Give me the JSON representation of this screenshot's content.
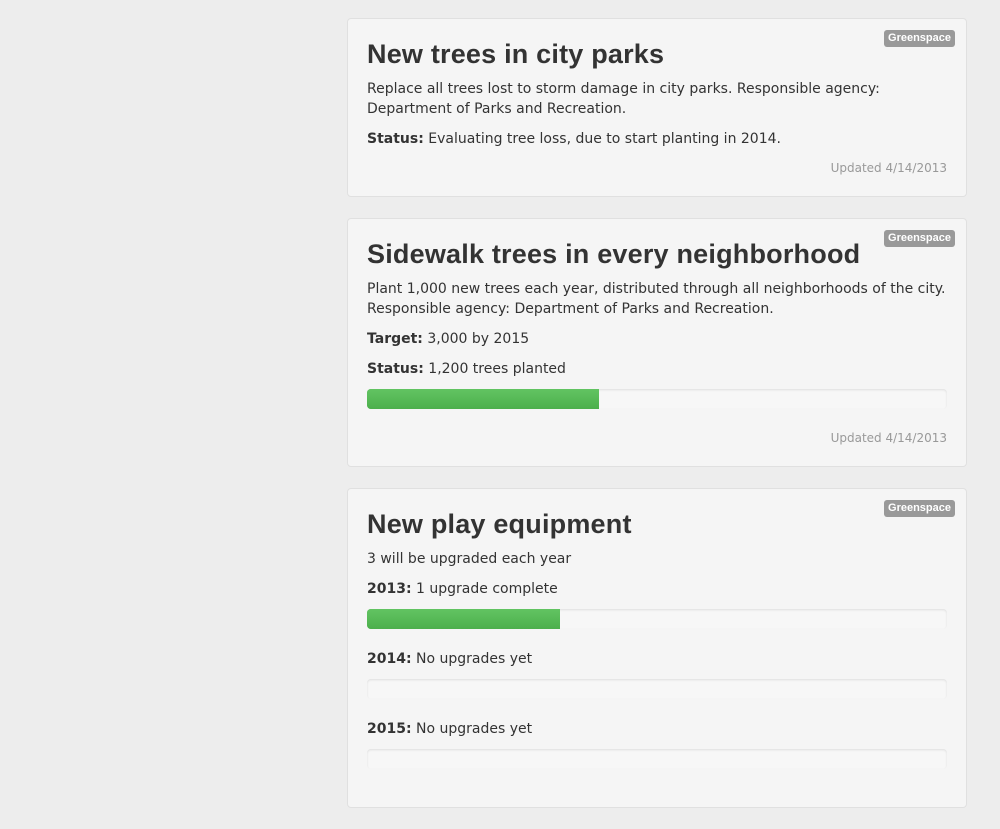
{
  "cards": [
    {
      "badge": "Greenspace",
      "title": "New trees in city parks",
      "description": "Replace all trees lost to storm damage in city parks. Responsible agency: Department of Parks and Recreation.",
      "status_label": "Status:",
      "status_text": "Evaluating tree loss, due to start planting in 2014.",
      "updated": "Updated 4/14/2013"
    },
    {
      "badge": "Greenspace",
      "title": "Sidewalk trees in every neighborhood",
      "description": "Plant 1,000 new trees each year, distributed through all neighborhoods of the city. Responsible agency: Department of Parks and Recreation.",
      "target_label": "Target:",
      "target_text": "3,000 by 2015",
      "status_label": "Status:",
      "status_text": "1,200 trees planted",
      "progress": 0.4,
      "updated": "Updated 4/14/2013"
    },
    {
      "badge": "Greenspace",
      "title": "New play equipment",
      "description": "3 will be upgraded each year",
      "years": [
        {
          "label": "2013:",
          "text": "1 upgrade complete",
          "progress": 0.333
        },
        {
          "label": "2014:",
          "text": "No upgrades yet",
          "progress": 0
        },
        {
          "label": "2015:",
          "text": "No upgrades yet",
          "progress": 0
        }
      ]
    }
  ],
  "colors": {
    "progress_fill": "#5cb85c",
    "badge_bg": "#999999",
    "page_bg": "#ededed"
  }
}
